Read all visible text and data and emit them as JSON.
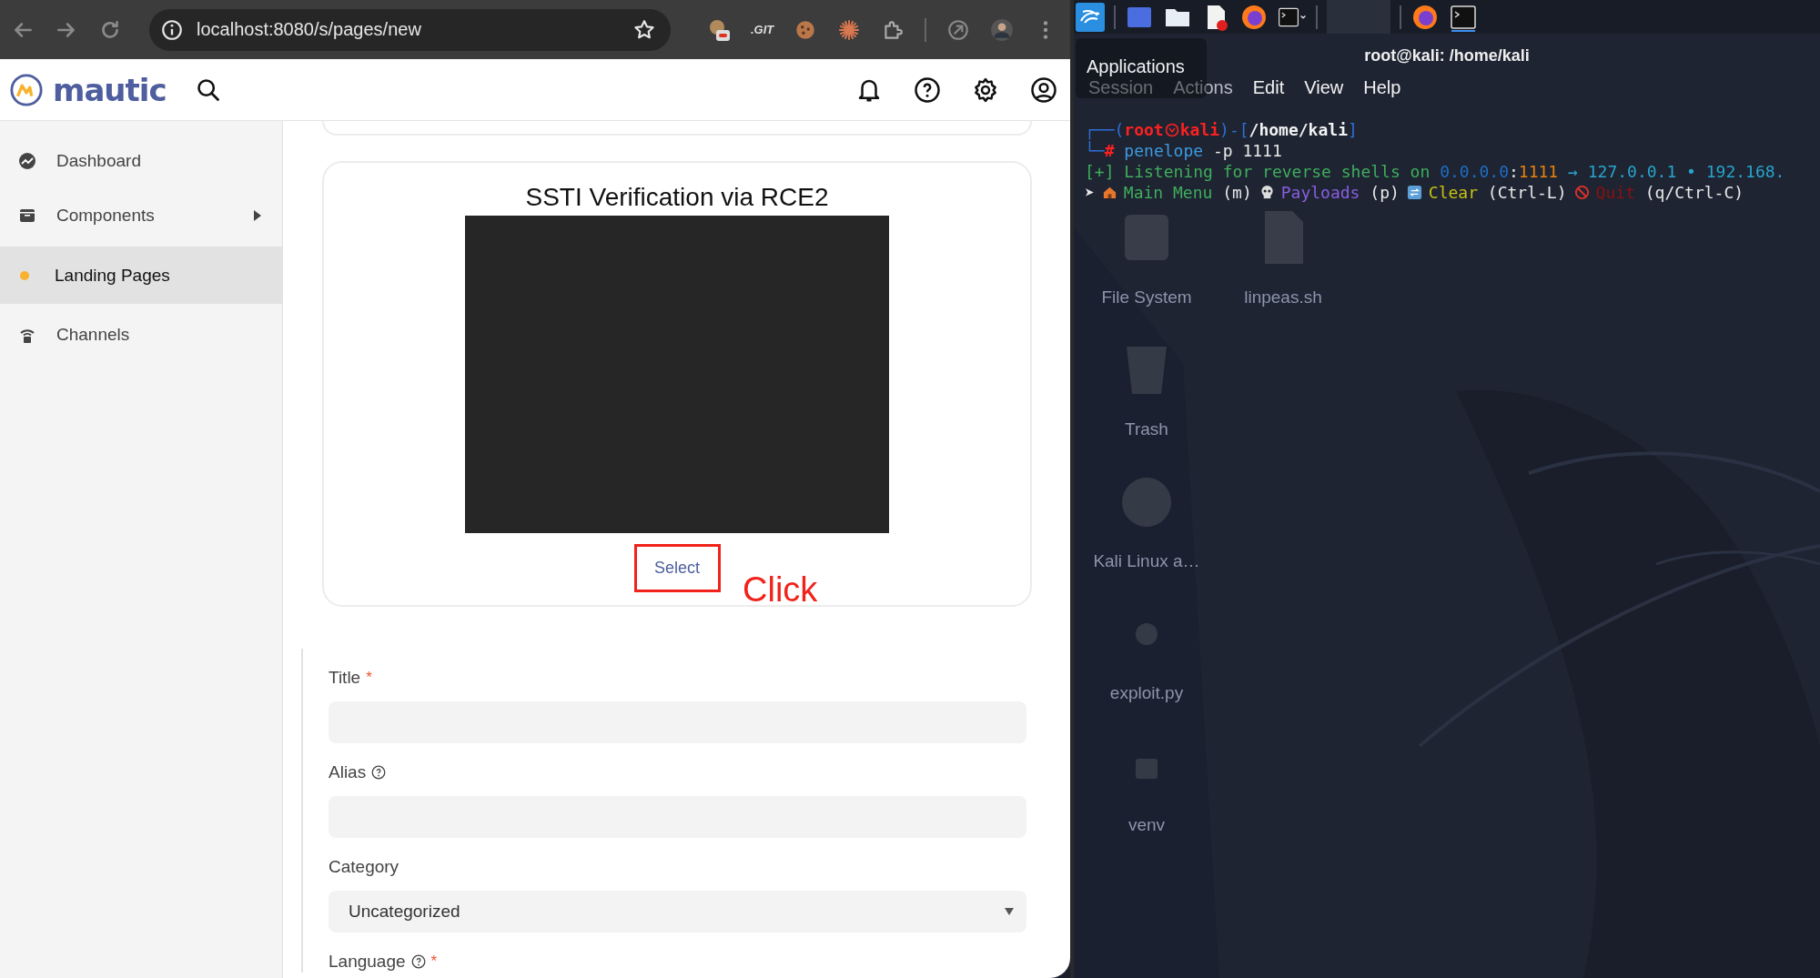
{
  "browser": {
    "url": "localhost:8080/s/pages/new",
    "extension_label": ".GIT"
  },
  "app": {
    "logo": "mautic",
    "sidebar": [
      {
        "label": "Dashboard",
        "selected": false,
        "expandable": false
      },
      {
        "label": "Components",
        "selected": false,
        "expandable": true
      },
      {
        "label": "Landing Pages",
        "selected": true,
        "expandable": false
      },
      {
        "label": "Channels",
        "selected": false,
        "expandable": false
      }
    ],
    "template_card": {
      "title": "SSTI Verification via RCE2",
      "button": "Select"
    },
    "annotation": {
      "label": "Click"
    },
    "form": [
      {
        "label": "Title",
        "required_mark": "*",
        "help": false,
        "kind": "text"
      },
      {
        "label": "Alias",
        "help": true,
        "kind": "text"
      },
      {
        "label": "Category",
        "help": false,
        "kind": "select",
        "value": "Uncategorized"
      },
      {
        "label": "Language",
        "required_mark": "*",
        "help": true,
        "kind": "label"
      }
    ]
  },
  "terminal": {
    "title": "root@kali: /home/kali",
    "tooltip": "Applications",
    "menu": [
      "Session",
      "Actions",
      "Edit",
      "View",
      "Help"
    ],
    "lines": [
      [
        {
          "kind": "text",
          "text": "┌──(",
          "color": "#2f6fd6",
          "bold": false
        },
        {
          "kind": "text",
          "text": "root",
          "color": "#ff2020",
          "bold": true
        },
        {
          "kind": "icon",
          "color": "#ff2020"
        },
        {
          "kind": "text",
          "text": "kali",
          "color": "#ff2020",
          "bold": true
        },
        {
          "kind": "text",
          "text": ")-[",
          "color": "#2f6fd6",
          "bold": false
        },
        {
          "kind": "text",
          "text": "/home/kali",
          "color": "#f2f2f2",
          "bold": true
        },
        {
          "kind": "text",
          "text": "]",
          "color": "#2f6fd6",
          "bold": false
        }
      ],
      [
        {
          "kind": "text",
          "text": "└─",
          "color": "#2f6fd6"
        },
        {
          "kind": "text",
          "text": "#",
          "color": "#ff2020",
          "bold": true
        },
        {
          "kind": "text",
          "text": " penelope",
          "color": "#3d9be0",
          "bold": false
        },
        {
          "kind": "text",
          "text": " -p 1111",
          "color": "#e8e8e8",
          "bold": false
        }
      ],
      [
        {
          "kind": "text",
          "text": "[+] Listening for reverse shells on ",
          "color": "#3fae5c",
          "bold": false
        },
        {
          "kind": "text",
          "text": "0.0.0.0",
          "color": "#1e6fc6",
          "bold": false
        },
        {
          "kind": "text",
          "text": ":",
          "color": "#e8e8e8",
          "bold": false
        },
        {
          "kind": "text",
          "text": "1111",
          "color": "#e8820f",
          "bold": false
        },
        {
          "kind": "text",
          "text": " → 127.0.0.1 • 192.168.",
          "color": "#27a5cc",
          "bold": false
        }
      ]
    ],
    "menu_hint": {
      "prompt": "➤",
      "entries": [
        {
          "label": "Main Menu",
          "key": "(m)",
          "color": "#3fae5c"
        },
        {
          "label": "Payloads",
          "key": "(p)",
          "color": "#8a5ee0"
        },
        {
          "label": "Clear",
          "key": "(Ctrl-L)",
          "color": "#c8c012"
        },
        {
          "label": "Quit",
          "key": "(q/Ctrl-C)",
          "color": "#8c1010"
        }
      ]
    },
    "desktop_icons": [
      {
        "label": "File System"
      },
      {
        "label": "linpeas.sh"
      },
      {
        "label": "Trash"
      },
      {
        "label": "Kali Linux a…"
      },
      {
        "label": "exploit.py"
      },
      {
        "label": "venv"
      }
    ]
  }
}
